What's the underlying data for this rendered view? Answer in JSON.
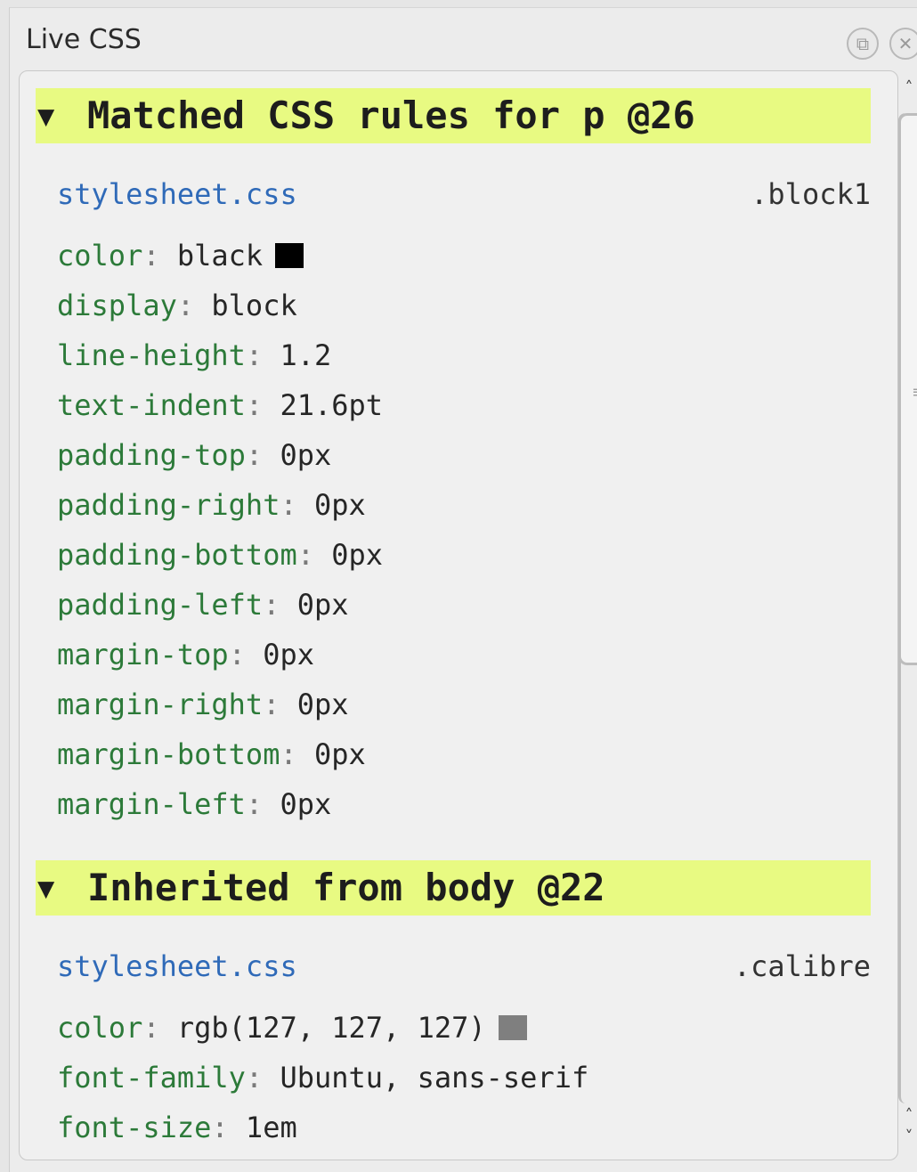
{
  "window": {
    "title": "Live CSS",
    "buttons": {
      "float": "⧉",
      "close": "✕"
    }
  },
  "sections": [
    {
      "arrow": "▼",
      "heading": "Matched CSS rules for p @26",
      "stylesheet": "stylesheet.css",
      "selector": ".block1",
      "properties": [
        {
          "name": "color",
          "value": "black",
          "swatch": "#000000"
        },
        {
          "name": "display",
          "value": "block"
        },
        {
          "name": "line-height",
          "value": "1.2"
        },
        {
          "name": "text-indent",
          "value": "21.6pt"
        },
        {
          "name": "padding-top",
          "value": "0px"
        },
        {
          "name": "padding-right",
          "value": "0px"
        },
        {
          "name": "padding-bottom",
          "value": "0px"
        },
        {
          "name": "padding-left",
          "value": "0px"
        },
        {
          "name": "margin-top",
          "value": "0px"
        },
        {
          "name": "margin-right",
          "value": "0px"
        },
        {
          "name": "margin-bottom",
          "value": "0px"
        },
        {
          "name": "margin-left",
          "value": "0px"
        }
      ]
    },
    {
      "arrow": "▼",
      "heading": "Inherited from body @22",
      "stylesheet": "stylesheet.css",
      "selector": ".calibre",
      "properties": [
        {
          "name": "color",
          "value": "rgb(127, 127, 127)",
          "swatch": "#7f7f7f"
        },
        {
          "name": "font-family",
          "value": "Ubuntu, sans-serif"
        },
        {
          "name": "font-size",
          "value": "1em"
        }
      ]
    }
  ],
  "colon": ":",
  "scrollbar": {
    "up_arrow": "˄",
    "down_arrow": "˄",
    "down_arrow_2": "˅",
    "grip": "≡"
  }
}
